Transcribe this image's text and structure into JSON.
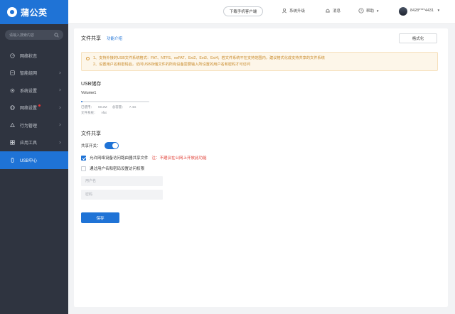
{
  "app": {
    "logo_text": "蒲公英"
  },
  "sidebar": {
    "search_placeholder": "请输入搜索内容",
    "items": [
      {
        "label": "网络状态",
        "icon": "status-icon",
        "has_chevron": false
      },
      {
        "label": "智能组网",
        "icon": "network-icon",
        "has_chevron": true
      },
      {
        "label": "系统设置",
        "icon": "gear-icon",
        "has_chevron": true
      },
      {
        "label": "网络设置",
        "icon": "globe-icon",
        "has_chevron": true,
        "badge": true
      },
      {
        "label": "行为管理",
        "icon": "behavior-icon",
        "has_chevron": true
      },
      {
        "label": "应用工具",
        "icon": "tools-icon",
        "has_chevron": true
      },
      {
        "label": "USB中心",
        "icon": "usb-icon",
        "has_chevron": false,
        "active": true
      }
    ]
  },
  "topbar": {
    "download_label": "下载手机客户端",
    "system_upgrade": "系统升级",
    "message": "消息",
    "help": "帮助",
    "account": "8428****4431"
  },
  "page": {
    "title": "文件共享",
    "title_link": "功能介绍",
    "mode_button": "格式化",
    "notice_lines": [
      "1、支持外接的USB文件系统格式：FAT、NTFS、exFAT、Ext2、Ext3、Ext4；若文件系统不在支持范围内，建议格式化成支持共享的文件系统",
      "2、设置用户名和密码后，访问USB存储文件的所有设备需要输入所设置的用户名和密码才可访问"
    ]
  },
  "usb": {
    "section_title": "USB储存",
    "volume_name": "Volume1",
    "used_label": "已使用：",
    "used_value": "59.2M",
    "capacity_label": "总容量：",
    "capacity_value": "7.4G",
    "fs_label": "文件系统：",
    "fs_value": "vfat",
    "used_fraction": 0.02
  },
  "share": {
    "section_title": "文件共享",
    "switch_label": "共享开关：",
    "switch_on": true,
    "allow_label": "允许网络设备访问路由器共享文件",
    "allow_checked": true,
    "warning": "注：不建议在公网上开放此功能",
    "auth_label": "通过用户名和密码设置访问权限",
    "auth_checked": false,
    "username_placeholder": "用户名",
    "password_placeholder": "密码",
    "save_label": "保存"
  },
  "colors": {
    "accent": "#1f73d6",
    "sidebar_bg": "#2f3440",
    "warning": "#e0392f",
    "notice_text": "#c88a2a"
  }
}
